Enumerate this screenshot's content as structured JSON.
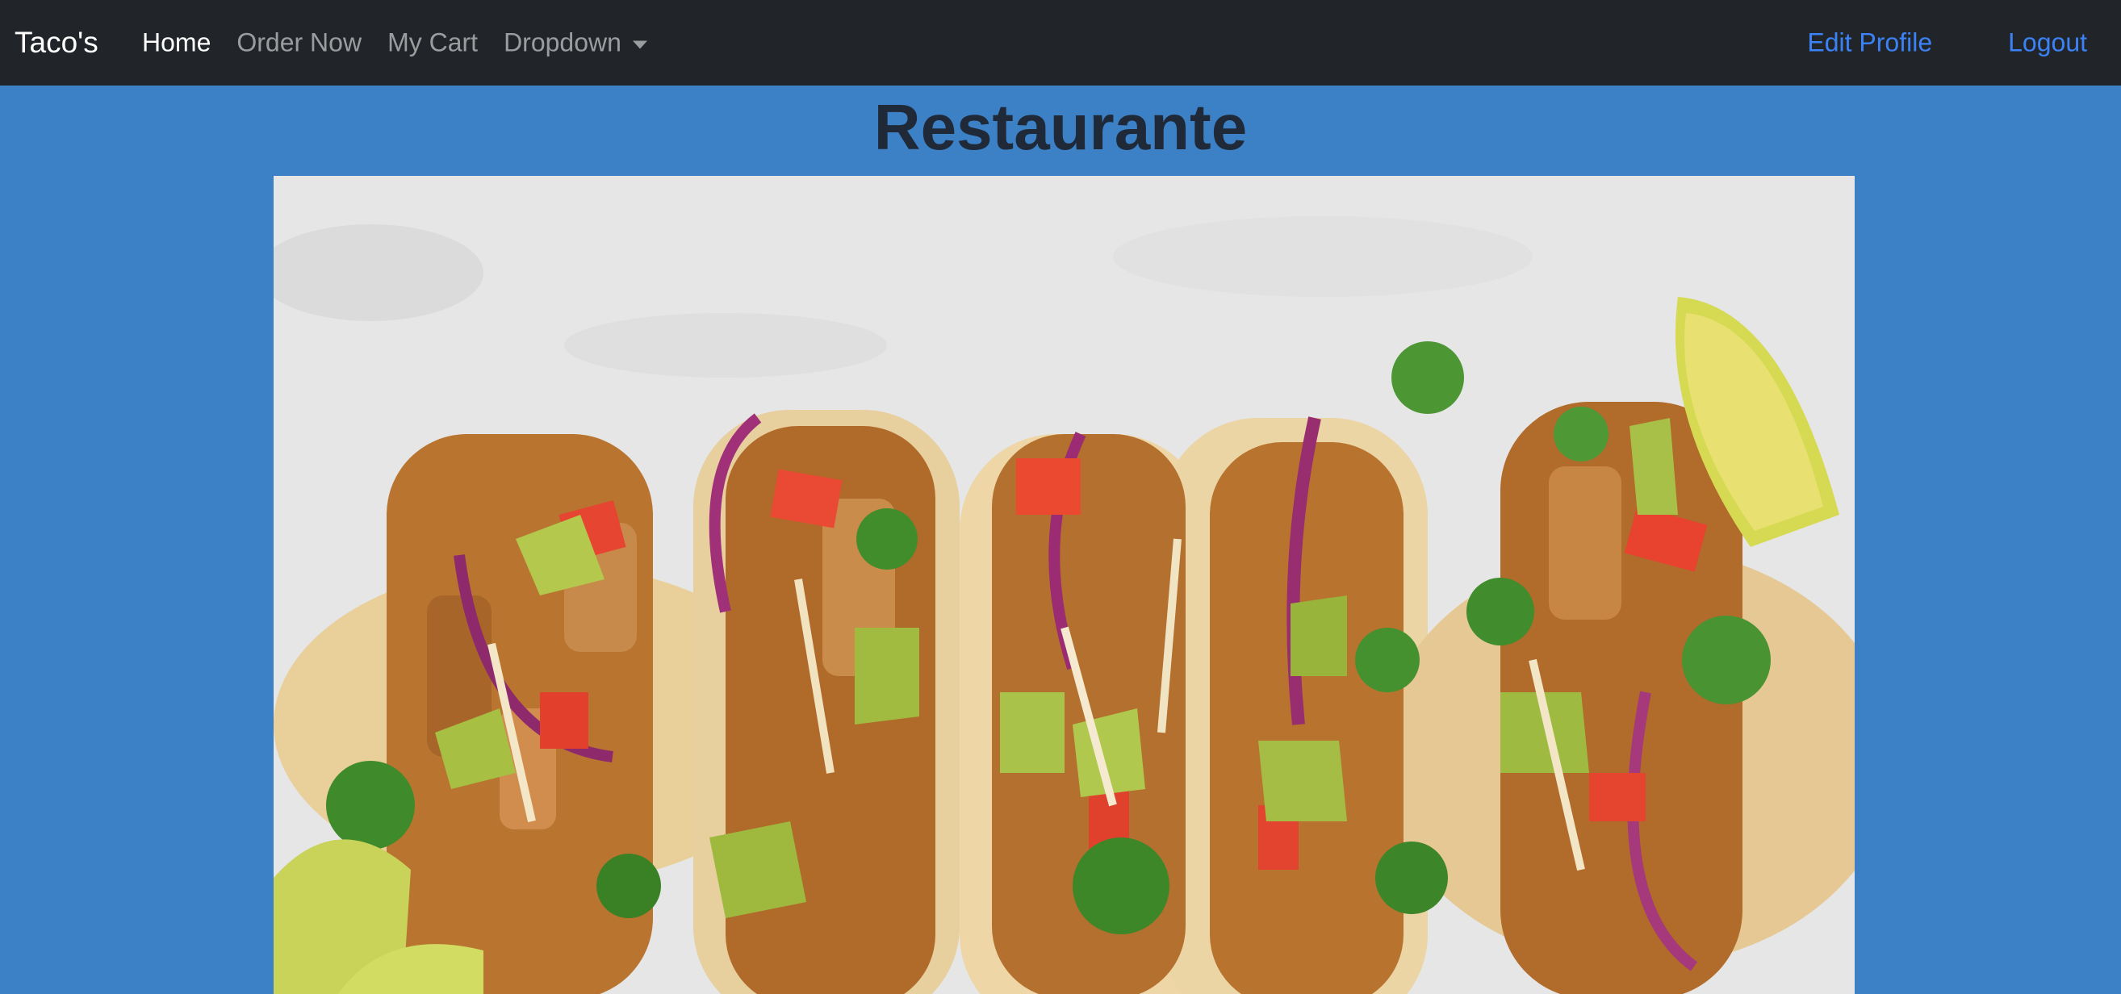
{
  "navbar": {
    "brand": "Taco's",
    "links": [
      {
        "label": "Home",
        "active": true
      },
      {
        "label": "Order Now",
        "active": false
      },
      {
        "label": "My Cart",
        "active": false
      },
      {
        "label": "Dropdown",
        "active": false,
        "has_caret": true
      }
    ],
    "right_links": [
      {
        "label": "Edit Profile"
      },
      {
        "label": "Logout"
      }
    ]
  },
  "page": {
    "title": "Restaurante"
  },
  "hero": {
    "alt": "tacos-photo"
  },
  "colors": {
    "navbar_bg": "#212529",
    "page_bg": "#3c80c6",
    "link_accent": "#3b82f6",
    "title": "#1f2937"
  }
}
